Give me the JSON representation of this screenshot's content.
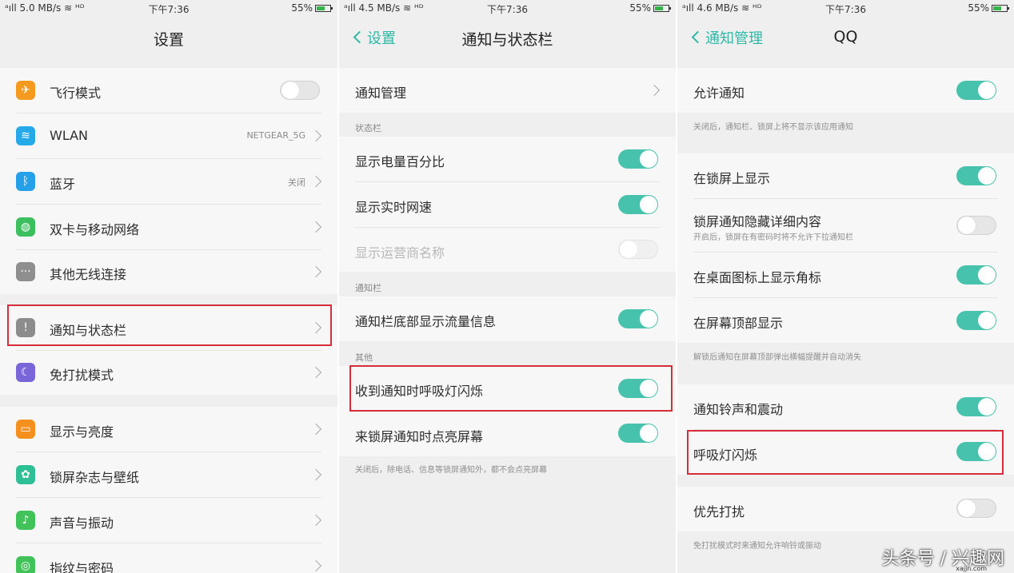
{
  "colors": {
    "accent": "#47c3ad",
    "back_text": "#2eb8a6",
    "highlight": "#d52d3a",
    "row_bg": "#f7f7f7",
    "bg": "#efefef"
  },
  "panel1": {
    "status": {
      "signal": "ᵃıll",
      "speed": "5.0 MB/s",
      "icons": "≋ ᴴᴰ",
      "time": "下午7:36",
      "battery": "55%"
    },
    "title": "设置",
    "items": [
      {
        "label": "飞行模式",
        "icon": "airplane-icon",
        "icon_color": "#f39a1f"
      },
      {
        "label": "WLAN",
        "value": "NETGEAR_5G",
        "icon": "wifi-icon",
        "icon_color": "#26a9e8"
      },
      {
        "label": "蓝牙",
        "value": "关闭",
        "icon": "bluetooth-icon",
        "icon_color": "#26a0e8"
      },
      {
        "label": "双卡与移动网络",
        "icon": "globe-icon",
        "icon_color": "#3cbf5e"
      },
      {
        "label": "其他无线连接",
        "icon": "more-icon",
        "icon_color": "#8f8f8f"
      },
      {
        "label": "通知与状态栏",
        "icon": "notification-icon",
        "icon_color": "#8c8c8c"
      },
      {
        "label": "免打扰模式",
        "icon": "moon-icon",
        "icon_color": "#7a66d9"
      },
      {
        "label": "显示与亮度",
        "icon": "display-icon",
        "icon_color": "#f4901e"
      },
      {
        "label": "锁屏杂志与壁纸",
        "icon": "flower-icon",
        "icon_color": "#2ebf96"
      },
      {
        "label": "声音与振动",
        "icon": "speaker-icon",
        "icon_color": "#42c35a"
      },
      {
        "label": "指纹与密码",
        "icon": "fingerprint-icon",
        "icon_color": "#42c35a"
      }
    ]
  },
  "panel2": {
    "status": {
      "signal": "ᵃıll",
      "speed": "4.5 MB/s",
      "icons": "≋ ᴴᴰ",
      "time": "下午7:36",
      "battery": "55%"
    },
    "back": "设置",
    "title": "通知与状态栏",
    "manage": "通知管理",
    "section_statusbar": "状态栏",
    "battery_percent": "显示电量百分比",
    "realtime_speed": "显示实时网速",
    "carrier_name": "显示运营商名称",
    "section_notifbar": "通知栏",
    "traffic_info": "通知栏底部显示流量信息",
    "section_other": "其他",
    "breath_light": "收到通知时呼吸灯闪烁",
    "wake_screen": "来锁屏通知时点亮屏幕",
    "wake_note": "关闭后，除电话、信息等锁屏通知外，都不会点亮屏幕"
  },
  "panel3": {
    "status": {
      "signal": "ᵃıll",
      "speed": "4.6 MB/s",
      "icons": "≋ ᴴᴰ",
      "time": "下午7:36",
      "battery": "55%"
    },
    "back": "通知管理",
    "title": "QQ",
    "allow": "允许通知",
    "allow_note": "关闭后，通知栏、锁屏上将不显示该应用通知",
    "lockscreen_show": "在锁屏上显示",
    "hide_details": "锁屏通知隐藏详细内容",
    "hide_details_sub": "开启后，锁屏在有密码时将不允许下拉通知栏",
    "badge": "在桌面图标上显示角标",
    "top_show": "在屏幕顶部显示",
    "top_note": "解锁后通知在屏幕顶部弹出横幅提醒并自动消失",
    "ring_vibrate": "通知铃声和震动",
    "breath_light": "呼吸灯闪烁",
    "priority": "优先打扰",
    "priority_note": "免打扰模式时来通知允许响铃或振动"
  },
  "watermark": {
    "text": "头条号 / 兴趣网",
    "small": "xajjn.com"
  }
}
